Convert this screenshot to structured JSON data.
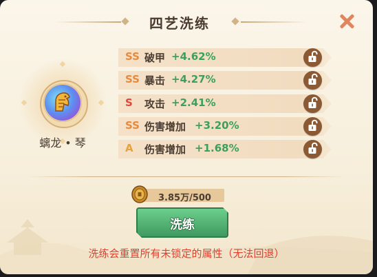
{
  "dialog": {
    "title": "四艺洗练",
    "close_icon": "close-x-icon"
  },
  "hero": {
    "name": "螭龙 • 琴",
    "icon": "qilin-orb-icon"
  },
  "attributes": [
    {
      "grade": "SS",
      "name": "破甲",
      "value": "+4.62%",
      "grade_color": "#e88a3a",
      "lock_icon": "unlocked-padlock-icon"
    },
    {
      "grade": "SS",
      "name": "暴击",
      "value": "+4.27%",
      "grade_color": "#e88a3a",
      "lock_icon": "unlocked-padlock-icon"
    },
    {
      "grade": "S",
      "name": "攻击",
      "value": "+2.41%",
      "grade_color": "#e0463a",
      "lock_icon": "unlocked-padlock-icon"
    },
    {
      "grade": "SS",
      "name": "伤害增加",
      "value": "+3.20%",
      "grade_color": "#e88a3a",
      "lock_icon": "unlocked-padlock-icon"
    },
    {
      "grade": "A",
      "name": "伤害增加",
      "value": "+1.68%",
      "grade_color": "#e8a23a",
      "lock_icon": "unlocked-padlock-icon"
    }
  ],
  "cost": {
    "text": "3.85万/500",
    "icon": "gold-coin-icon"
  },
  "actions": {
    "wash_label": "洗练"
  },
  "warning": "洗练会重置所有未锁定的属性（无法回退）",
  "colors": {
    "value_green": "#3aa15d",
    "button_green": "#4fae6e",
    "warning_red": "#e0402e",
    "lock_brown": "#8b5a34"
  }
}
